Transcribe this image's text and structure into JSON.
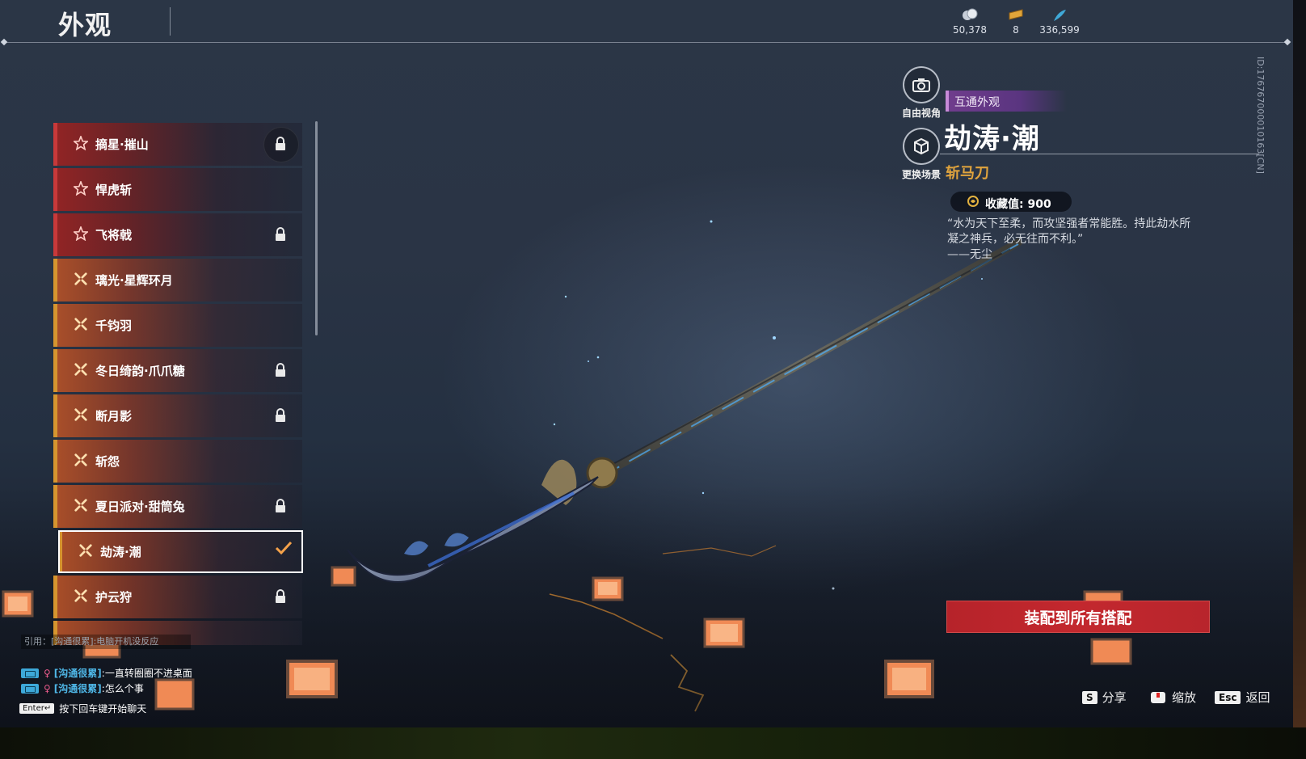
{
  "header": {
    "title": "外观"
  },
  "currencies": [
    {
      "icon": "coin-icon",
      "value": "50,378"
    },
    {
      "icon": "ticket-icon",
      "value": "8"
    },
    {
      "icon": "feather-icon",
      "value": "336,599"
    }
  ],
  "appearance_list": [
    {
      "name": "摘星·摧山",
      "rarity": "red",
      "locked": true
    },
    {
      "name": "悍虎斩",
      "rarity": "red",
      "locked": false
    },
    {
      "name": "飞将戟",
      "rarity": "red",
      "locked": true
    },
    {
      "name": "璃光·星辉环月",
      "rarity": "gold",
      "locked": false
    },
    {
      "name": "千钧羽",
      "rarity": "gold",
      "locked": false
    },
    {
      "name": "冬日绮韵·爪爪糖",
      "rarity": "gold",
      "locked": true
    },
    {
      "name": "断月影",
      "rarity": "gold",
      "locked": true
    },
    {
      "name": "斩怨",
      "rarity": "gold",
      "locked": false
    },
    {
      "name": "夏日派对·甜筒兔",
      "rarity": "gold",
      "locked": true
    },
    {
      "name": "劫涛·潮",
      "rarity": "gold",
      "locked": false,
      "selected": true
    },
    {
      "name": "护云狩",
      "rarity": "gold",
      "locked": true
    }
  ],
  "side_buttons": {
    "free_view": "自由视角",
    "change_scene": "更换场景"
  },
  "detail": {
    "tag": "互通外观",
    "title": "劫涛·潮",
    "weapon_type": "斩马刀",
    "collect_value": "收藏值: 900",
    "quote_line1": "“水为天下至柔，而攻坚强者常能胜。持此劫水所",
    "quote_line2": "凝之神兵，必无往而不利。”",
    "quote_line3": "——无尘",
    "id_text": "ID:176767000010163[CN]"
  },
  "equip_button": "装配到所有搭配",
  "hints": {
    "share_key": "S",
    "share": "分享",
    "zoom": "缩放",
    "back_key": "Esc",
    "back": "返回"
  },
  "chat": {
    "quote": "引用：[沟通很累]:电脑开机没反应",
    "lines": [
      {
        "who": "[沟通很累]",
        "text": ":一直转圈圈不进桌面"
      },
      {
        "who": "[沟通很累]",
        "text": ":怎么个事"
      }
    ],
    "enter_key": "Enter↵",
    "enter_hint": "按下回车键开始聊天"
  },
  "colors": {
    "red_rarity": "#c8393a",
    "gold_rarity": "#d6952f",
    "tag_purple": "#6f3c8c",
    "weapon_type": "#e1a43d",
    "equip_red": "#c3282e"
  }
}
